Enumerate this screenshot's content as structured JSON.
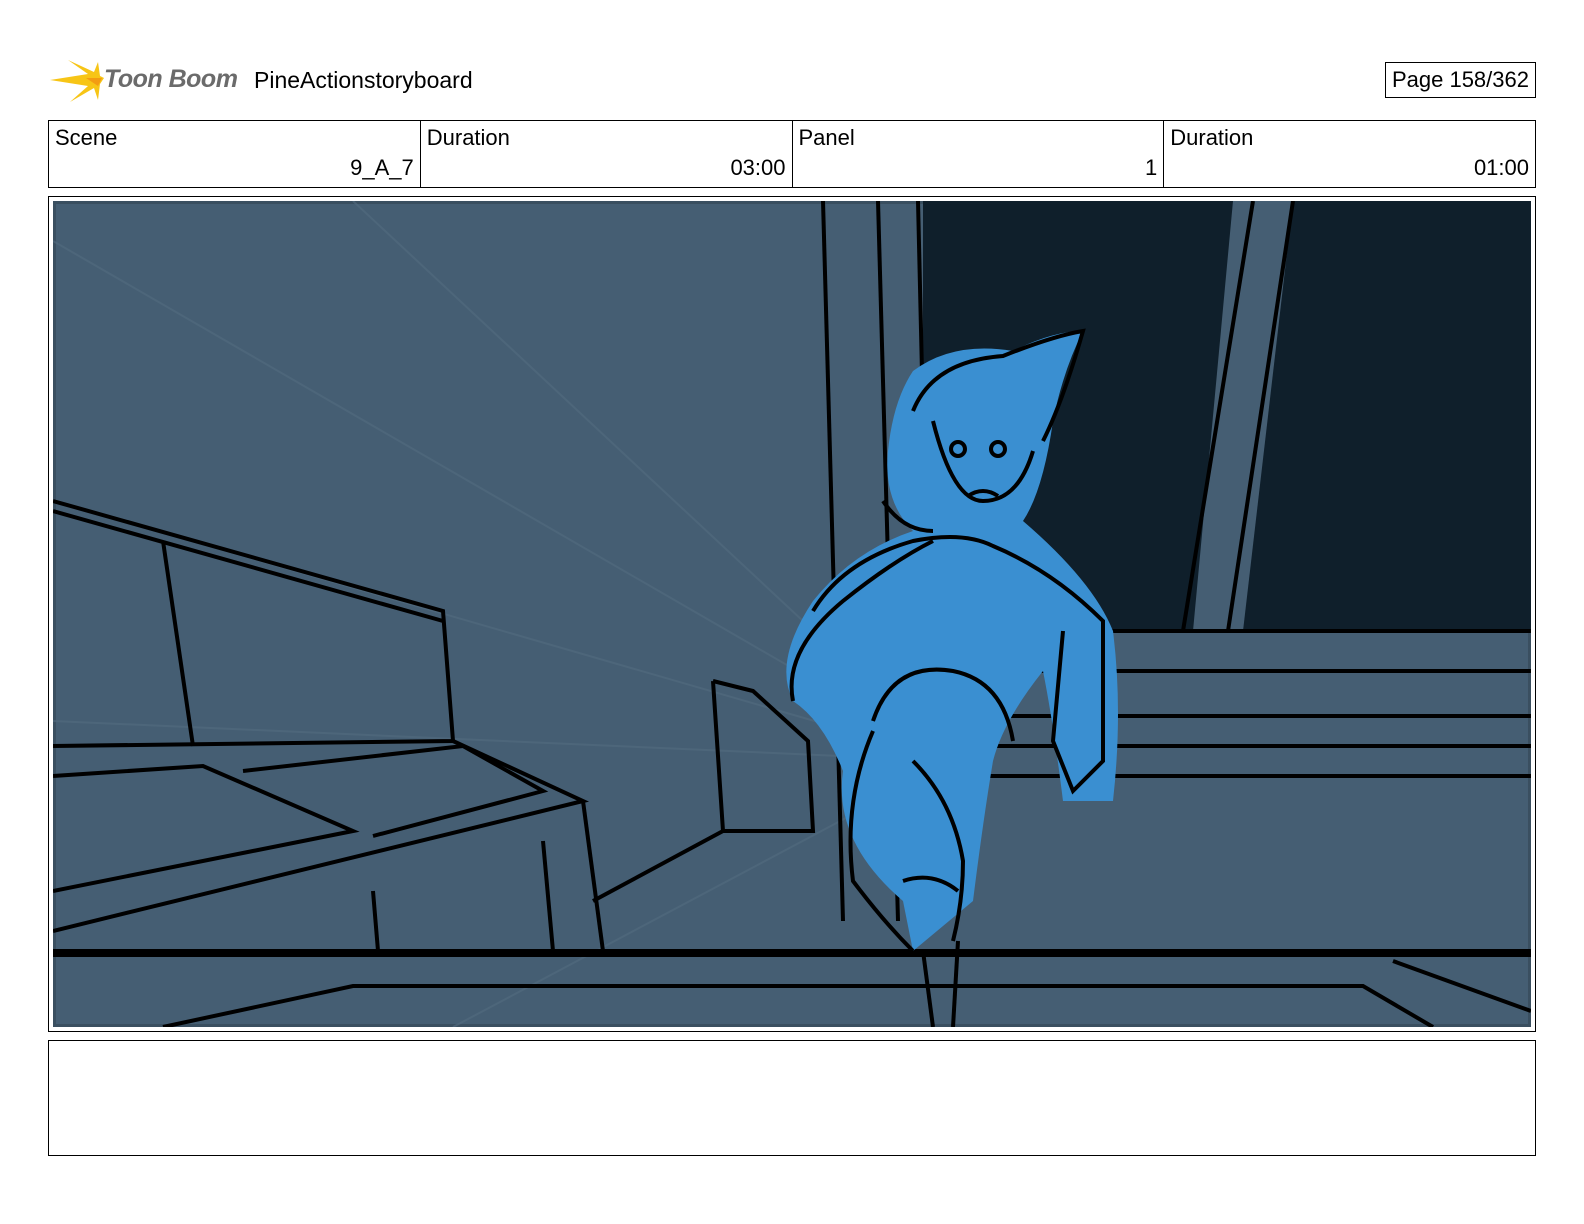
{
  "header": {
    "logo_text": "Toon Boom",
    "project_title": "PineActionstoryboard",
    "page_label": "Page 158/362"
  },
  "info": {
    "scene": {
      "label": "Scene",
      "value": "9_A_7"
    },
    "scene_duration": {
      "label": "Duration",
      "value": "03:00"
    },
    "panel": {
      "label": "Panel",
      "value": "1"
    },
    "panel_duration": {
      "label": "Duration",
      "value": "01:00"
    }
  },
  "panel_image": {
    "description_colors": {
      "background": "#455e73",
      "window_dark": "#0f1f2b",
      "character": "#3a8fd1"
    }
  },
  "notes": {
    "text": ""
  }
}
